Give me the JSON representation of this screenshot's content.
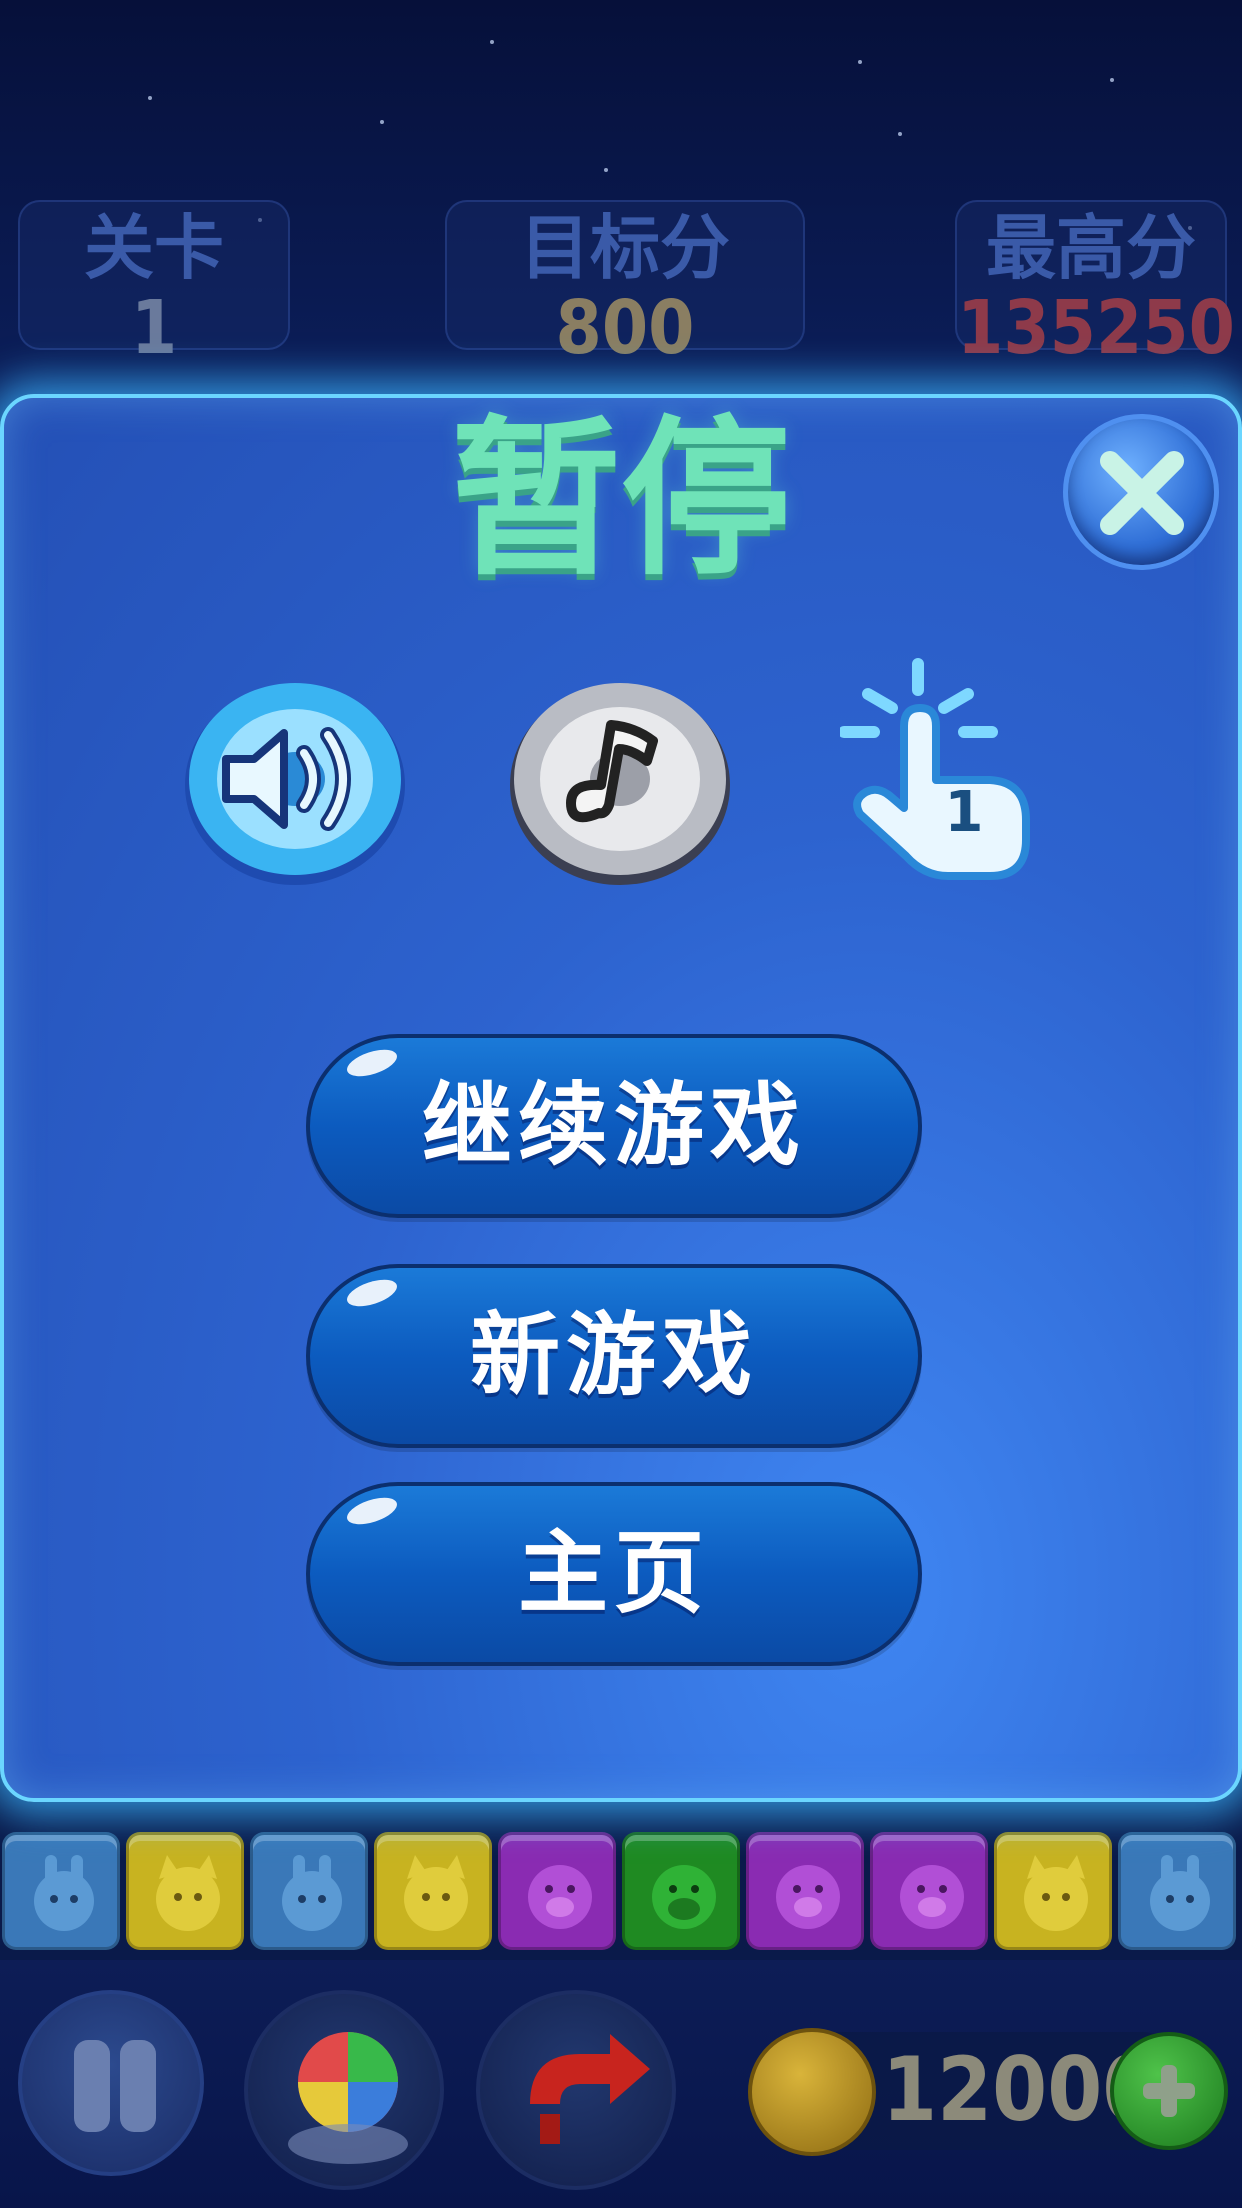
{
  "header": {
    "level": {
      "label": "关卡",
      "value": "1"
    },
    "target": {
      "label": "目标分",
      "value": "800"
    },
    "best": {
      "label": "最高分",
      "value": "135250"
    }
  },
  "dialog": {
    "title": "暂停",
    "close_icon": "close-icon",
    "settings": {
      "sound_icon": "speaker-icon",
      "music_icon": "music-note-icon",
      "hint_icon": "tap-finger-icon",
      "hint_count": "1"
    },
    "buttons": {
      "continue": "继续游戏",
      "new_game": "新游戏",
      "home": "主页"
    }
  },
  "board": {
    "bottom_row": [
      "rabbit",
      "cat",
      "rabbit",
      "cat",
      "pig",
      "dog",
      "pig",
      "pig",
      "cat",
      "rabbit"
    ]
  },
  "footer": {
    "pause_icon": "pause-icon",
    "tools": [
      "color-ball-icon",
      "refresh-icon"
    ],
    "coins": "12000",
    "add_coins_icon": "plus-icon"
  },
  "colors": {
    "title": "#6fe3b8",
    "dialog_border": "#6bd6ff",
    "button_blue": "#0c5bbf",
    "best_score": "#8e3a4a",
    "target_score": "#8a7e62"
  }
}
